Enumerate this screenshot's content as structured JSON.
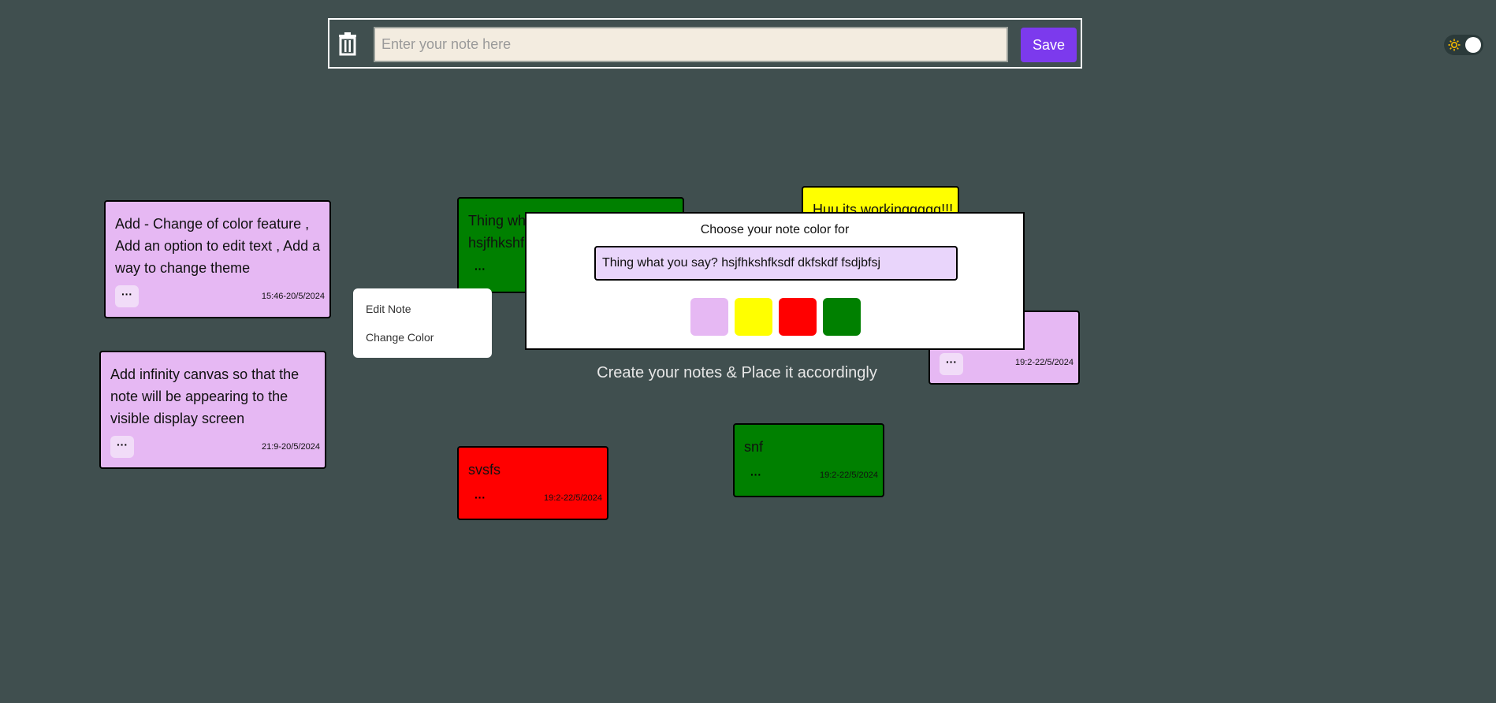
{
  "toolbar": {
    "input_placeholder": "Enter your note here",
    "save_label": "Save"
  },
  "notes": [
    {
      "text": "Add - Change of color feature , Add an option to edit text , Add a way to change theme",
      "date": "15:46-20/5/2024",
      "menu": "···",
      "color": "#e6b8f3"
    },
    {
      "text": "Add infinity canvas so that the note will be appearing to the visible display screen",
      "date": "21:9-20/5/2024",
      "menu": "···",
      "color": "#e6b8f3"
    },
    {
      "text": "Thing what you say? hsjfhkshfksdf dkfskdf fsdjbfsj",
      "visible_text": "Thing wh",
      "visible_text2": "hsjfhkshf",
      "menu": "···",
      "color": "#008000"
    },
    {
      "text": "Huu its workinggggg!!!",
      "color": "#ffff00"
    },
    {
      "text": "",
      "date": "19:2-22/5/2024",
      "menu": "···",
      "color": "#e6b8f3"
    },
    {
      "text": "svsfs",
      "date": "19:2-22/5/2024",
      "menu": "···",
      "color": "#ff0000"
    },
    {
      "text": "snf",
      "date": "19:2-22/5/2024",
      "menu": "···",
      "color": "#008000"
    }
  ],
  "context_menu": {
    "items": [
      "Edit Note",
      "Change Color"
    ]
  },
  "color_dialog": {
    "title": "Choose your note color for",
    "note_preview": "Thing what you say? hsjfhkshfksdf dkfskdf fsdjbfsj",
    "swatches": [
      "#e6b8f3",
      "#ffff00",
      "#ff0000",
      "#008000"
    ]
  },
  "tagline": "Create your notes & Place it accordingly",
  "icons": {
    "trash": "trash-icon",
    "theme": "sun-icon"
  }
}
